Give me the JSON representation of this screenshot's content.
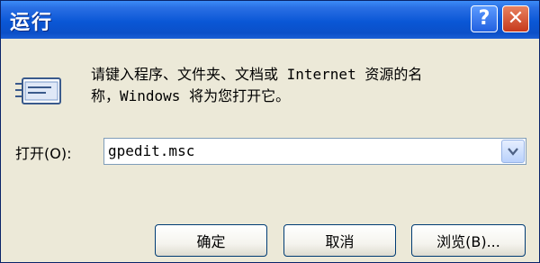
{
  "window": {
    "title": "运行"
  },
  "titlebar": {
    "help_label": "?",
    "close_label": "✕"
  },
  "description": {
    "line1": "请键入程序、文件夹、文档或 Internet 资源的名",
    "line2": "称，Windows 将为您打开它。"
  },
  "open_field": {
    "label": "打开(O):",
    "value": "gpedit.msc"
  },
  "buttons": {
    "ok": "确定",
    "cancel": "取消",
    "browse": "浏览(B)..."
  },
  "icons": {
    "run": "run-program-icon",
    "dropdown": "chevron-down-icon"
  },
  "colors": {
    "titlebar": "#0b4fc8",
    "dialog_bg": "#ece9d8",
    "close": "#c6391c"
  }
}
